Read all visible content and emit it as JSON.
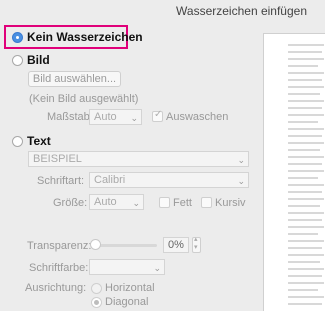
{
  "window": {
    "title": "Wasserzeichen einfügen"
  },
  "options": {
    "kein": "Kein Wasserzeichen",
    "bild": "Bild",
    "text": "Text"
  },
  "bild": {
    "select_button": "Bild auswählen...",
    "status": "(Kein Bild ausgewählt)",
    "scale_label": "Maßstab:",
    "scale_value": "Auto",
    "washout_label": "Auswaschen"
  },
  "text": {
    "text_value": "BEISPIEL",
    "font_label": "Schriftart:",
    "font_value": "Calibri",
    "size_label": "Größe:",
    "size_value": "Auto",
    "bold_label": "Fett",
    "italic_label": "Kursiv",
    "transparency_label": "Transparenz:",
    "transparency_value": "0%",
    "color_label": "Schriftfarbe:",
    "orientation_label": "Ausrichtung:",
    "horizontal_label": "Horizontal",
    "diagonal_label": "Diagonal"
  }
}
